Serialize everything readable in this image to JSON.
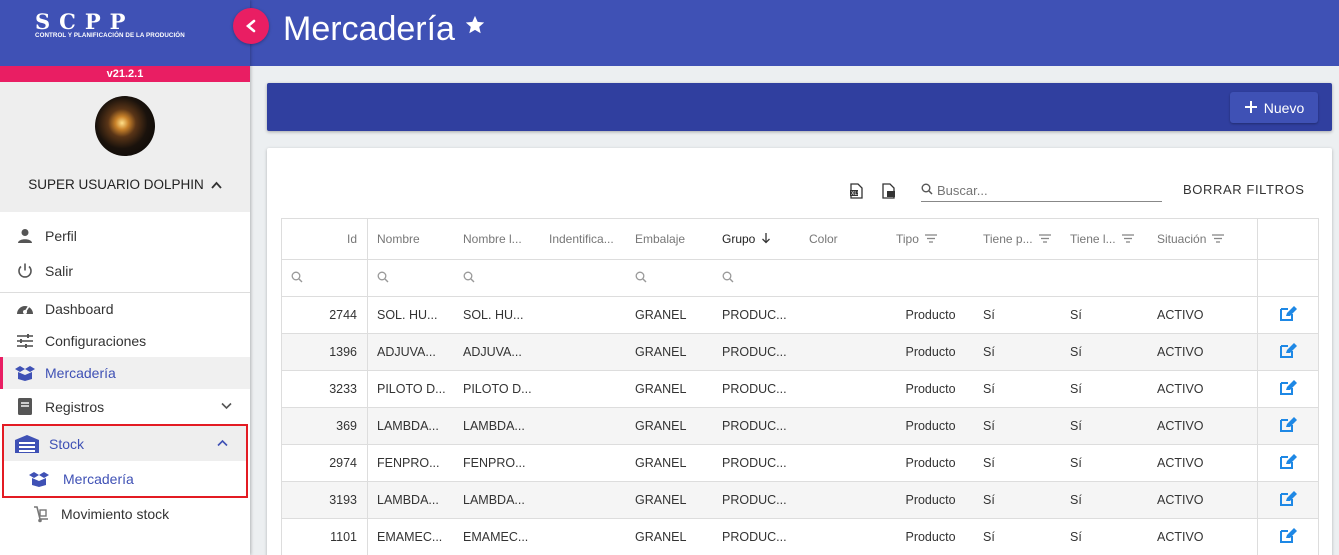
{
  "app": {
    "logo_text": "SCPP",
    "logo_subtitle": "CONTROL Y PLANIFICACIÓN DE LA PRODUCIÓN",
    "version": "v21.2.1"
  },
  "user": {
    "name": "SUPER USUARIO DOLPHIN"
  },
  "sidebar": {
    "account_items": [
      {
        "label": "Perfil",
        "icon": "person-icon"
      },
      {
        "label": "Salir",
        "icon": "power-icon"
      }
    ],
    "items": [
      {
        "label": "Dashboard",
        "icon": "speedometer-icon"
      },
      {
        "label": "Configuraciones",
        "icon": "sliders-icon"
      },
      {
        "label": "Mercadería",
        "icon": "box-icon",
        "active": true
      },
      {
        "label": "Registros",
        "icon": "book-icon"
      },
      {
        "label": "Stock",
        "icon": "warehouse-icon",
        "expanded": true
      },
      {
        "label": "Mercadería",
        "icon": "box-icon"
      },
      {
        "label": "Movimiento stock",
        "icon": "dolly-icon"
      }
    ]
  },
  "header": {
    "title": "Mercadería"
  },
  "toolbar": {
    "new_label": "Nuevo"
  },
  "grid": {
    "search_placeholder": "Buscar...",
    "clear_filters_label": "BORRAR FILTROS",
    "columns": [
      "Id",
      "Nombre",
      "Nombre l...",
      "Indentifica...",
      "Embalaje",
      "Grupo",
      "Color",
      "Tipo",
      "Tiene p...",
      "Tiene l...",
      "Situación"
    ],
    "rows": [
      [
        "2744",
        "SOL. HU...",
        "SOL. HU...",
        "",
        "GRANEL",
        "PRODUC...",
        "",
        "Producto",
        "Sí",
        "Sí",
        "ACTIVO"
      ],
      [
        "1396",
        "ADJUVA...",
        "ADJUVA...",
        "",
        "GRANEL",
        "PRODUC...",
        "",
        "Producto",
        "Sí",
        "Sí",
        "ACTIVO"
      ],
      [
        "3233",
        "PILOTO D...",
        "PILOTO D...",
        "",
        "GRANEL",
        "PRODUC...",
        "",
        "Producto",
        "Sí",
        "Sí",
        "ACTIVO"
      ],
      [
        "369",
        "LAMBDA...",
        "LAMBDA...",
        "",
        "GRANEL",
        "PRODUC...",
        "",
        "Producto",
        "Sí",
        "Sí",
        "ACTIVO"
      ],
      [
        "2974",
        "FENPRO...",
        "FENPRO...",
        "",
        "GRANEL",
        "PRODUC...",
        "",
        "Producto",
        "Sí",
        "Sí",
        "ACTIVO"
      ],
      [
        "3193",
        "LAMBDA...",
        "LAMBDA...",
        "",
        "GRANEL",
        "PRODUC...",
        "",
        "Producto",
        "Sí",
        "Sí",
        "ACTIVO"
      ],
      [
        "1101",
        "EMAMEC...",
        "EMAMEC...",
        "",
        "GRANEL",
        "PRODUC...",
        "",
        "Producto",
        "Sí",
        "Sí",
        "ACTIVO"
      ]
    ]
  },
  "colors": {
    "primary": "#3f51b5",
    "primary_dark": "#303f9f",
    "accent": "#e91e63",
    "highlight_border": "#e31b23",
    "edit_icon": "#1e88e5"
  }
}
